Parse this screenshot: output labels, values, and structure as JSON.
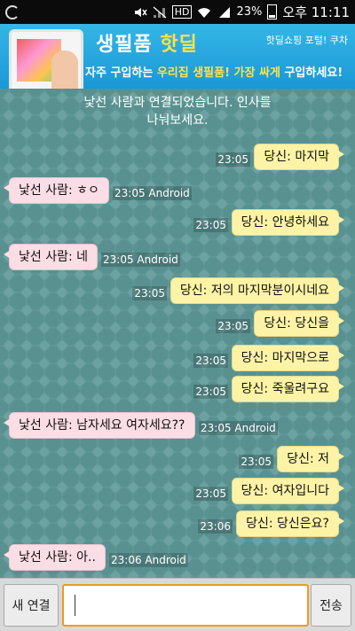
{
  "status_bar": {
    "hd_label": "HD",
    "battery": "23%",
    "time": "오후 11:11"
  },
  "ad": {
    "title_part1": "생필품",
    "title_part2": "핫딜",
    "corner": "핫딜쇼핑 포털! 쿠차",
    "subtitle_part1": "자주 구입하는 ",
    "subtitle_highlight": "우리집 생필품! 가장 싸게",
    "subtitle_part2": " 구입하세요!"
  },
  "notice": {
    "line1": "낯선 사람과 연결되었습니다. 인사를",
    "line2": "나눠보세요."
  },
  "messages": [
    {
      "sender": "me",
      "text": "당신: 마지막",
      "time": "23:05"
    },
    {
      "sender": "them",
      "text": "낯선 사람: ㅎㅇ",
      "time": "23:05 Android"
    },
    {
      "sender": "me",
      "text": "당신: 안녕하세요",
      "time": "23:05"
    },
    {
      "sender": "them",
      "text": "낯선 사람: 네",
      "time": "23:05 Android"
    },
    {
      "sender": "me",
      "text": "당신: 저의 마지막분이시네요",
      "time": "23:05"
    },
    {
      "sender": "me",
      "text": "당신: 당신을",
      "time": "23:05"
    },
    {
      "sender": "me",
      "text": "당신: 마지막으로",
      "time": "23:05"
    },
    {
      "sender": "me",
      "text": "당신: 죽울려구요",
      "time": "23:05"
    },
    {
      "sender": "them",
      "text": "낯선 사람: 남자세요 여자세요??",
      "time": "23:05 Android"
    },
    {
      "sender": "me",
      "text": "당신: 저",
      "time": "23:05"
    },
    {
      "sender": "me",
      "text": "당신: 여자입니다",
      "time": "23:05"
    },
    {
      "sender": "me",
      "text": "당신: 당신은요?",
      "time": "23:06"
    },
    {
      "sender": "them",
      "text": "낯선 사람: 아..",
      "time": "23:06 Android"
    }
  ],
  "bottom": {
    "new_connection_label": "새 연결",
    "input_value": "",
    "send_label": "전송"
  },
  "colors": {
    "chat_bg": "#5f9a99",
    "my_bubble": "#fdf3a6",
    "their_bubble": "#fbdde6",
    "input_focus": "#f29a1c"
  }
}
